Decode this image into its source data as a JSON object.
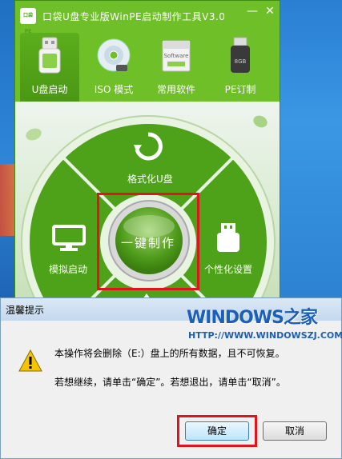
{
  "app": {
    "title": "口袋U盘专业版WinPE启动制作工具V3.0",
    "logo_text": "口袋PE",
    "minimize_glyph": "—",
    "close_glyph": "✕"
  },
  "tabs": [
    {
      "label": "U盘启动",
      "icon": "usb-drive-icon",
      "active": true
    },
    {
      "label": "ISO 模式",
      "icon": "disc-icon",
      "active": false
    },
    {
      "label": "常用软件",
      "icon": "software-box-icon",
      "active": false,
      "icon_text": "Software"
    },
    {
      "label": "PE订制",
      "icon": "usb-stick-8gb-icon",
      "active": false,
      "icon_text": "8GB"
    }
  ],
  "wheel": {
    "format_label": "格式化U盘",
    "simulate_label": "模拟启动",
    "personalize_label": "个性化设置",
    "center_label": "一键制作"
  },
  "dialog": {
    "title": "温馨提示",
    "brand": "WINDOWS之家",
    "brand_url": "HTTP://WWW.WINDOWSZJ.COM",
    "message_line1": "本操作将会删除（E:）盘上的所有数据，且不可恢复。",
    "message_line2": "若想继续，请单击“确定”。若想退出，请单击“取消”。",
    "ok_label": "确定",
    "cancel_label": "取消"
  },
  "colors": {
    "app_green": "#6fbf28",
    "wheel_green": "#4ea21a",
    "highlight_red": "#e0141c",
    "brand_blue": "#1b5fb8"
  }
}
